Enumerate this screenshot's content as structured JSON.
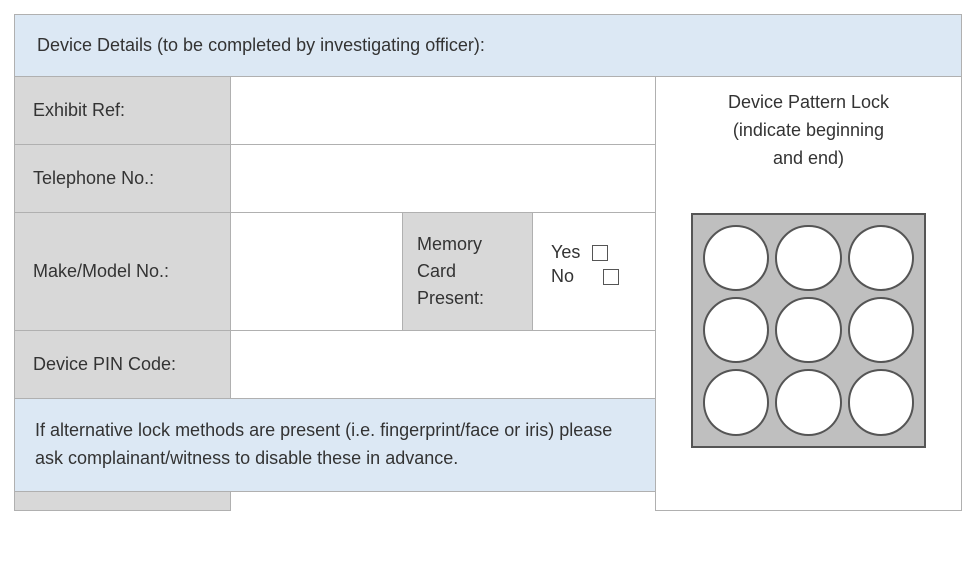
{
  "header": "Device Details (to be completed by investigating officer):",
  "rows": {
    "exhibit_label": "Exhibit Ref:",
    "telephone_label": "Telephone No.:",
    "make_label": "Make/Model No.:",
    "memory_label": "Memory Card Present:",
    "yes_label": "Yes",
    "no_label": "No",
    "pin_label": "Device PIN Code:"
  },
  "note": "If alternative lock methods are present (i.e. fingerprint/face or iris) please ask complainant/witness to disable these in advance.",
  "pattern": {
    "title_line1": "Device Pattern Lock",
    "title_line2": "(indicate beginning",
    "title_line3": "and end)"
  }
}
